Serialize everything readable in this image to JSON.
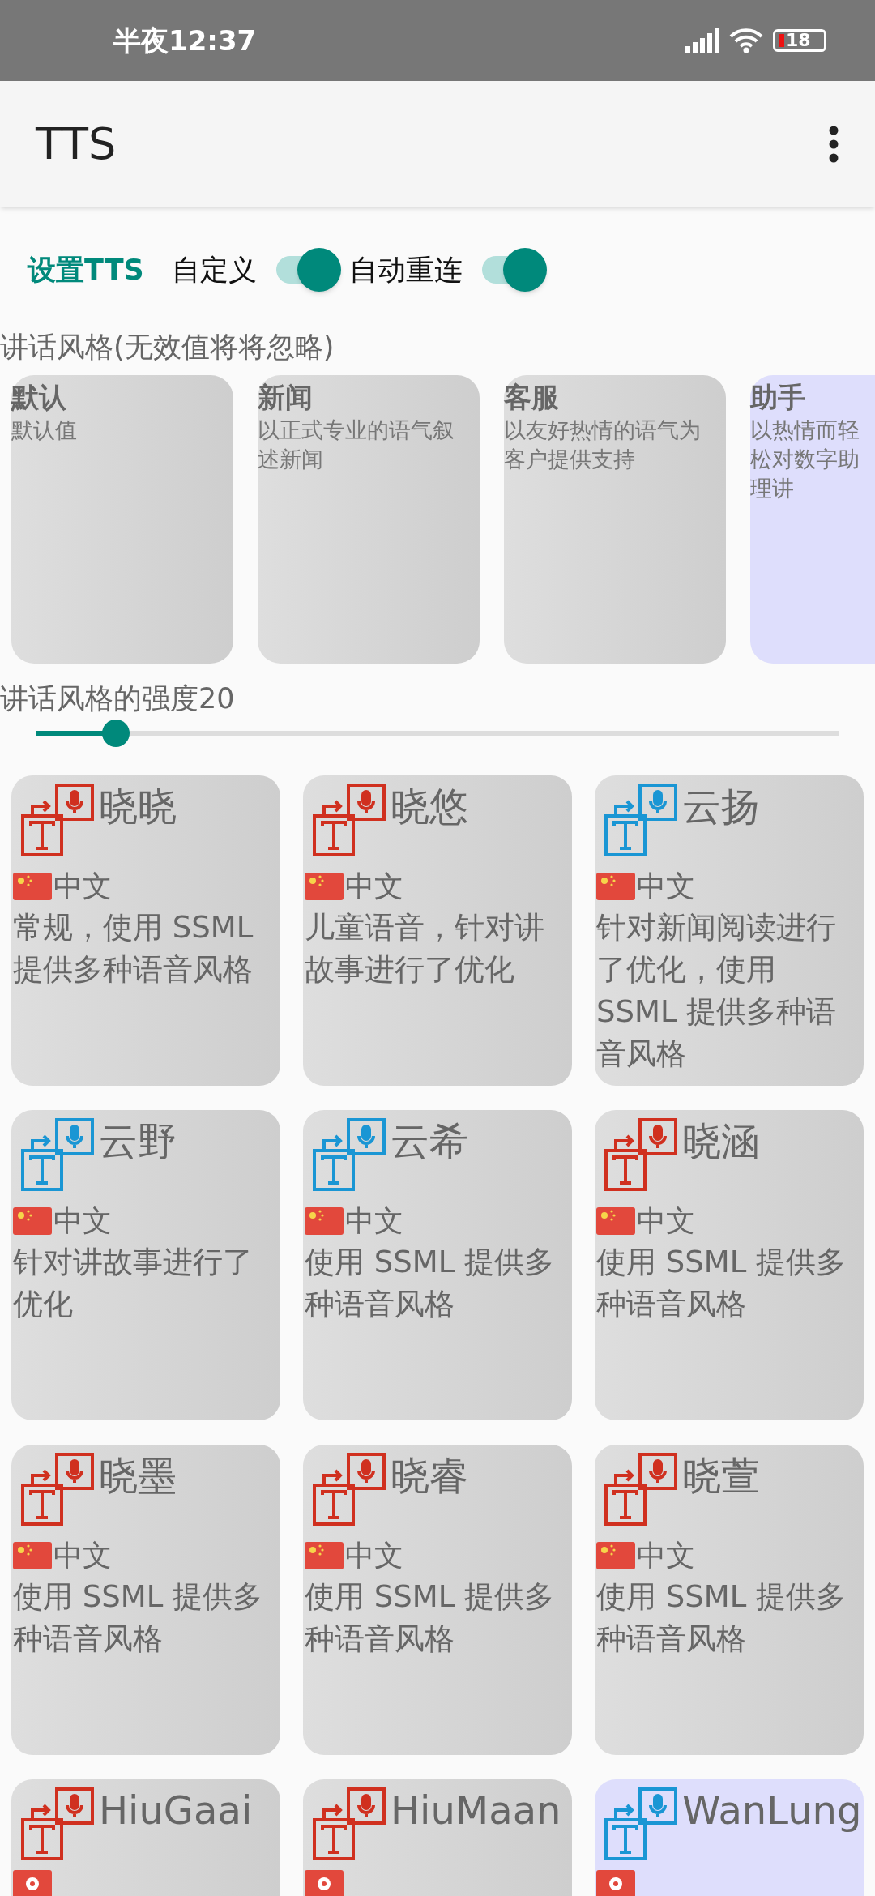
{
  "status_bar": {
    "time": "半夜12:37",
    "battery": "18"
  },
  "app_bar": {
    "title": "TTS"
  },
  "settings": {
    "heading": "设置TTS",
    "toggles": [
      {
        "label": "自定义",
        "on": true
      },
      {
        "label": "自动重连",
        "on": true
      }
    ]
  },
  "styles": {
    "label": "讲话风格(无效值将将忽略)",
    "items": [
      {
        "name": "默认",
        "description": "默认值",
        "selected": false
      },
      {
        "name": "新闻",
        "description": "以正式专业的语气叙述新闻",
        "selected": false
      },
      {
        "name": "客服",
        "description": "以友好热情的语气为客户提供支持",
        "selected": false
      },
      {
        "name": "助手",
        "description": "以热情而轻松对数字助理讲",
        "selected": true
      }
    ]
  },
  "strength": {
    "label": "讲话风格的强度20",
    "level": 0.1
  },
  "voices": [
    {
      "name": "晓晓",
      "kind": "cn",
      "language": "中文",
      "description": "常规，使用 SSML 提供多种语音风格",
      "color": "#d0301f",
      "selected": false
    },
    {
      "name": "晓悠",
      "kind": "cn",
      "language": "中文",
      "description": "儿童语音，针对讲故事进行了优化",
      "color": "#d0301f",
      "selected": false
    },
    {
      "name": "云扬",
      "kind": "cn",
      "language": "中文",
      "description": "针对新闻阅读进行了优化，使用 SSML 提供多种语音风格",
      "color": "#1a96d4",
      "selected": false
    },
    {
      "name": "云野",
      "kind": "cn",
      "language": "中文",
      "description": "针对讲故事进行了优化",
      "color": "#1a96d4",
      "selected": false
    },
    {
      "name": "云希",
      "kind": "cn",
      "language": "中文",
      "description": "使用 SSML 提供多种语音风格",
      "color": "#1a96d4",
      "selected": false
    },
    {
      "name": "晓涵",
      "kind": "cn",
      "language": "中文",
      "description": "使用 SSML 提供多种语音风格",
      "color": "#d0301f",
      "selected": false
    },
    {
      "name": "晓墨",
      "kind": "cn",
      "language": "中文",
      "description": "使用 SSML 提供多种语音风格",
      "color": "#d0301f",
      "selected": false
    },
    {
      "name": "晓睿",
      "kind": "cn",
      "language": "中文",
      "description": "使用 SSML 提供多种语音风格",
      "color": "#d0301f",
      "selected": false
    },
    {
      "name": "晓萱",
      "kind": "cn",
      "language": "中文",
      "description": "使用 SSML 提供多种语音风格",
      "color": "#d0301f",
      "selected": false
    },
    {
      "name": "HiuGaai",
      "kind": "hk",
      "color": "#d0301f",
      "selected": false
    },
    {
      "name": "HiuMaan",
      "kind": "hk",
      "color": "#d0301f",
      "selected": false
    },
    {
      "name": "WanLung",
      "kind": "hk",
      "color": "#1a96d4",
      "selected": true
    }
  ]
}
